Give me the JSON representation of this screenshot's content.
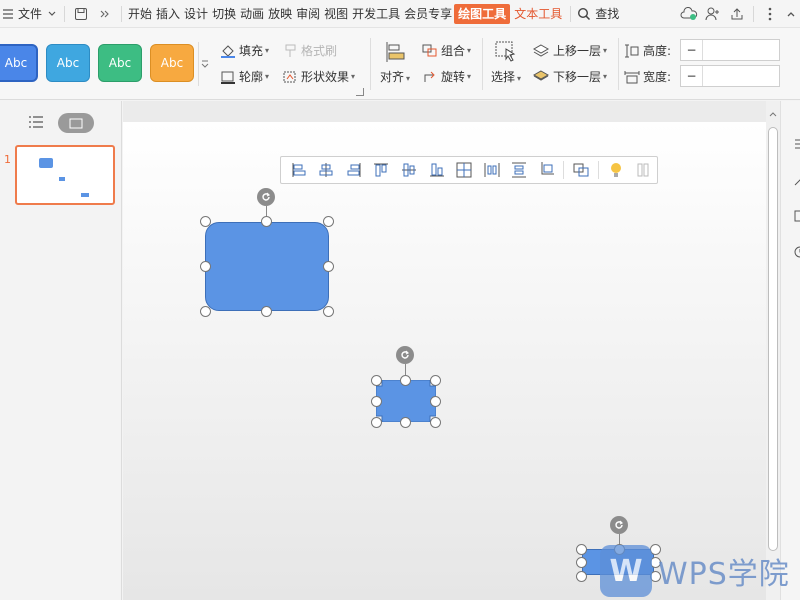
{
  "menubar": {
    "file": "文件",
    "tabs": [
      "开始",
      "插入",
      "设计",
      "切换",
      "动画",
      "放映",
      "审阅",
      "视图",
      "开发工具",
      "会员专享"
    ],
    "active_tab": "绘图工具",
    "text_tool_tab": "文本工具",
    "search": "查找"
  },
  "ribbon": {
    "styles": [
      {
        "label": "Abc",
        "color": "#4a86e8"
      },
      {
        "label": "Abc",
        "color": "#3fa7e0"
      },
      {
        "label": "Abc",
        "color": "#3dbd83"
      },
      {
        "label": "Abc",
        "color": "#f7a940"
      }
    ],
    "fill": "填充",
    "format_painter": "格式刷",
    "outline": "轮廓",
    "shape_effects": "形状效果",
    "align": "对齐",
    "group": "组合",
    "rotate": "旋转",
    "select": "选择",
    "bring_forward": "上移一层",
    "send_backward": "下移一层",
    "height_label": "高度:",
    "width_label": "宽度:",
    "height_value": "",
    "width_value": "",
    "minus": "−"
  },
  "slides": {
    "current_number": "1"
  },
  "watermark": {
    "logo": "W",
    "text": "WPS学院"
  },
  "colors": {
    "accent": "#ef6c3a",
    "shape_fill": "#5b94e4",
    "thumb_border": "#ef7b4b"
  }
}
